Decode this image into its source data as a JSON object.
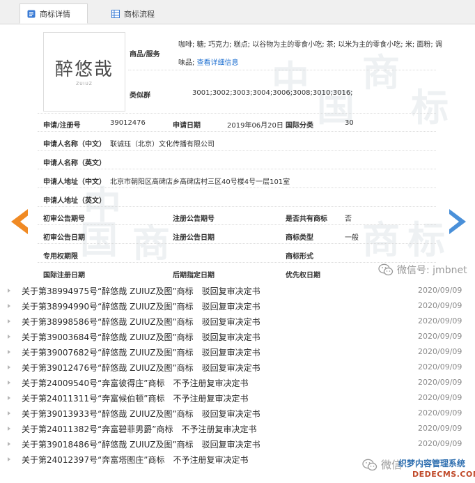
{
  "tabs": [
    {
      "label": "商标详情",
      "active": true
    },
    {
      "label": "商标流程",
      "active": false
    }
  ],
  "logo": {
    "mark": "醉悠哉",
    "sub": "ZUIUZ"
  },
  "goods": {
    "label": "商品/服务",
    "text_line1": "咖啡; 糖; 巧克力; 糕点; 以谷物为主的零食小吃; 茶; 以米为主的零食小吃; 米; 面粉; 调",
    "text_line2_prefix": "味品;",
    "detail_link": "查看详细信息"
  },
  "similar_group": {
    "label": "类似群",
    "value": "3001;3002;3003;3004;3006;3008;3010;3016;"
  },
  "fields": {
    "reg_no_label": "申请/注册号",
    "reg_no": "39012476",
    "apply_date_label": "申请日期",
    "apply_date": "2019年06月20日",
    "class_label": "国际分类",
    "class_value": "30",
    "applicant_cn_label": "申请人名称（中文）",
    "applicant_cn": "联诚珏（北京）文化传播有限公司",
    "applicant_en_label": "申请人名称（英文）",
    "address_cn_label": "申请人地址（中文）",
    "address_cn": "北京市朝阳区高碑店乡高碑店村三区40号楼4号一层101室",
    "address_en_label": "申请人地址（英文）",
    "prelim_no_label": "初审公告期号",
    "reg_pub_no_label": "注册公告期号",
    "shared_label": "是否共有商标",
    "shared_value": "否",
    "prelim_date_label": "初审公告日期",
    "reg_pub_date_label": "注册公告日期",
    "type_label": "商标类型",
    "type_value": "一般",
    "exclusive_label": "专用权期限",
    "form_label": "商标形式",
    "intl_date_label": "国际注册日期",
    "later_date_label": "后期指定日期",
    "priority_label": "优先权日期"
  },
  "wechat_top": "微信号: jmbnet",
  "wechat_bottom": "微信",
  "watermark_chars": [
    "中",
    "国",
    "商",
    "标"
  ],
  "decisions": [
    {
      "title": "关于第38994975号“醉悠哉 ZUIUZ及图”商标　驳回复审决定书",
      "date": "2020/09/09"
    },
    {
      "title": "关于第38994990号“醉悠哉 ZUIUZ及图”商标　驳回复审决定书",
      "date": "2020/09/09"
    },
    {
      "title": "关于第38998586号“醉悠哉 ZUIUZ及图”商标　驳回复审决定书",
      "date": "2020/09/09"
    },
    {
      "title": "关于第39003684号“醉悠哉 ZUIUZ及图”商标　驳回复审决定书",
      "date": "2020/09/09"
    },
    {
      "title": "关于第39007682号“醉悠哉 ZUIUZ及图”商标　驳回复审决定书",
      "date": "2020/09/09"
    },
    {
      "title": "关于第39012476号“醉悠哉 ZUIUZ及图”商标　驳回复审决定书",
      "date": "2020/09/09"
    },
    {
      "title": "关于第24009540号“奔富彼得庄”商标　不予注册复审决定书",
      "date": "2020/09/09"
    },
    {
      "title": "关于第24011311号“奔富候伯顿”商标　不予注册复审决定书",
      "date": "2020/09/09"
    },
    {
      "title": "关于第39013933号“醉悠哉 ZUIUZ及图”商标　驳回复审决定书",
      "date": "2020/09/09"
    },
    {
      "title": "关于第24011382号“奔富碧菲男爵”商标　不予注册复审决定书",
      "date": "2020/09/09"
    },
    {
      "title": "关于第39018486号“醉悠哉 ZUIUZ及图”商标　驳回复审决定书",
      "date": "2020/09/09"
    },
    {
      "title": "关于第24012397号“奔富塔图庄”商标　不予注册复审决定书",
      "date": "2020/09/09"
    }
  ],
  "badge": {
    "line1": "织梦内容管理系统",
    "line2": "DEDECMS.COM"
  },
  "colors": {
    "arrow_prev": "#f08a24",
    "arrow_next": "#4a90d9",
    "link": "#1e6fd0"
  }
}
